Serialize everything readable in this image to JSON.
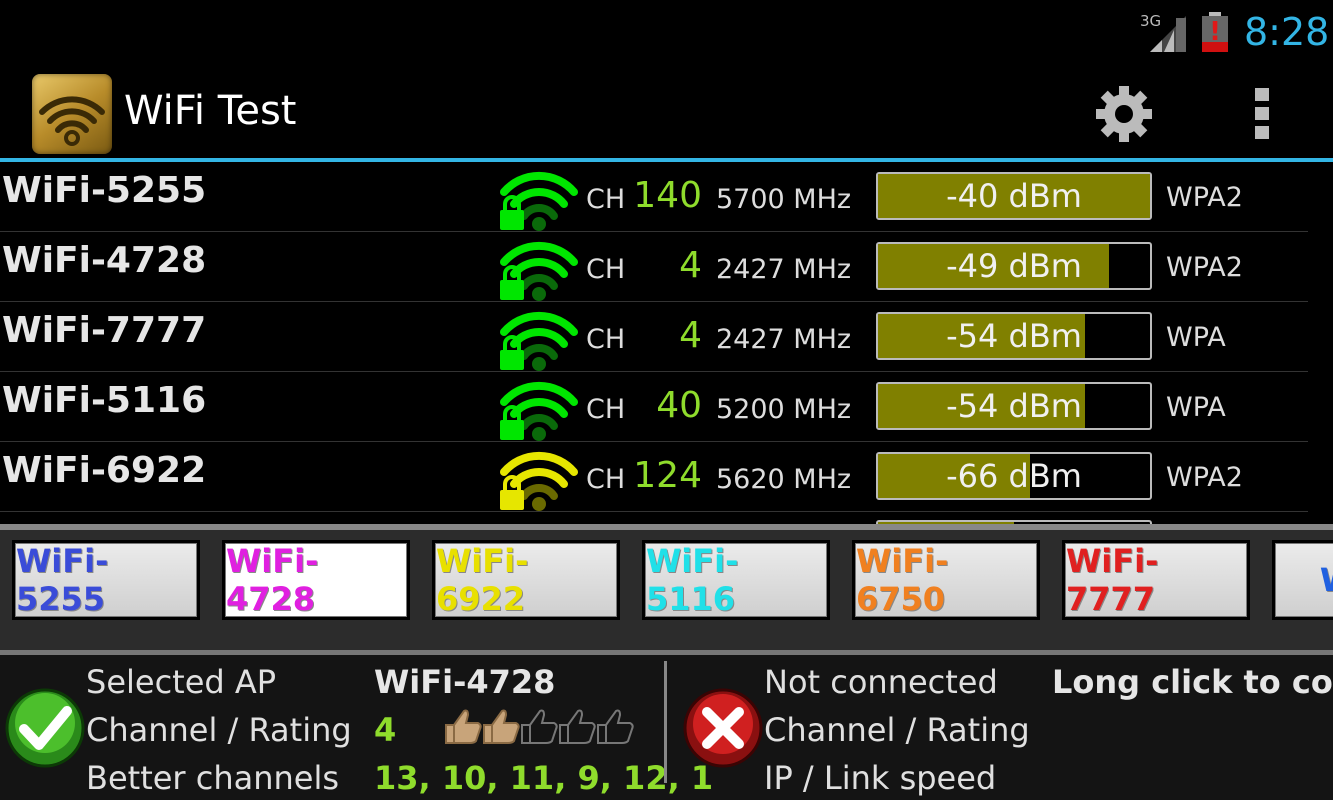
{
  "status_bar": {
    "network_type": "3G",
    "time": "8:28",
    "battery_alert": "!"
  },
  "action_bar": {
    "title": "WiFi Test",
    "settings_icon": "gear-icon",
    "overflow_icon": "overflow-menu-icon"
  },
  "ap_list": [
    {
      "ssid": "WiFi-5255",
      "ch_label": "CH",
      "channel": "140",
      "freq": "5700 MHz",
      "signal": "-40 dBm",
      "signal_dbm": -40,
      "signal_fraction": 1.0,
      "security": "WPA2",
      "icon_color": "#00e600"
    },
    {
      "ssid": "WiFi-4728",
      "ch_label": "CH",
      "channel": "4",
      "freq": "2427 MHz",
      "signal": "-49 dBm",
      "signal_dbm": -49,
      "signal_fraction": 0.85,
      "security": "WPA2",
      "icon_color": "#00e600"
    },
    {
      "ssid": "WiFi-7777",
      "ch_label": "CH",
      "channel": "4",
      "freq": "2427 MHz",
      "signal": "-54 dBm",
      "signal_dbm": -54,
      "signal_fraction": 0.76,
      "security": "WPA",
      "icon_color": "#00e600"
    },
    {
      "ssid": "WiFi-5116",
      "ch_label": "CH",
      "channel": "40",
      "freq": "5200 MHz",
      "signal": "-54 dBm",
      "signal_dbm": -54,
      "signal_fraction": 0.76,
      "security": "WPA",
      "icon_color": "#00e600"
    },
    {
      "ssid": "WiFi-6922",
      "ch_label": "CH",
      "channel": "124",
      "freq": "5620 MHz",
      "signal": "-66 dBm",
      "signal_dbm": -66,
      "signal_fraction": 0.56,
      "security": "WPA2",
      "icon_color": "#e6e600"
    }
  ],
  "chips": [
    {
      "label": "WiFi-5255",
      "color": "#3a4cd8",
      "selected": false
    },
    {
      "label": "WiFi-4728",
      "color": "#e020e0",
      "selected": true
    },
    {
      "label": "WiFi-6922",
      "color": "#e8e000",
      "selected": false
    },
    {
      "label": "WiFi-5116",
      "color": "#20e0e8",
      "selected": false
    },
    {
      "label": "WiFi-6750",
      "color": "#f08020",
      "selected": false
    },
    {
      "label": "WiFi-7777",
      "color": "#e02020",
      "selected": false
    },
    {
      "label": "WiFi-",
      "color": "#2060e0",
      "selected": false
    }
  ],
  "selected_panel": {
    "selected_ap_label": "Selected AP",
    "selected_ap_value": "WiFi-4728",
    "channel_rating_label": "Channel / Rating",
    "channel_value": "4",
    "rating": 2,
    "rating_max": 5,
    "better_channels_label": "Better channels",
    "better_channels_value": "13, 10, 11, 9, 12, 1"
  },
  "connection_panel": {
    "status_label": "Not connected",
    "channel_rating_label": "Channel / Rating",
    "ip_link_label": "IP / Link speed",
    "hint": "Long click to conn"
  },
  "colors": {
    "accent_blue": "#33b5e5",
    "channel_green": "#8fdc2c",
    "bar_fill": "#808000"
  }
}
